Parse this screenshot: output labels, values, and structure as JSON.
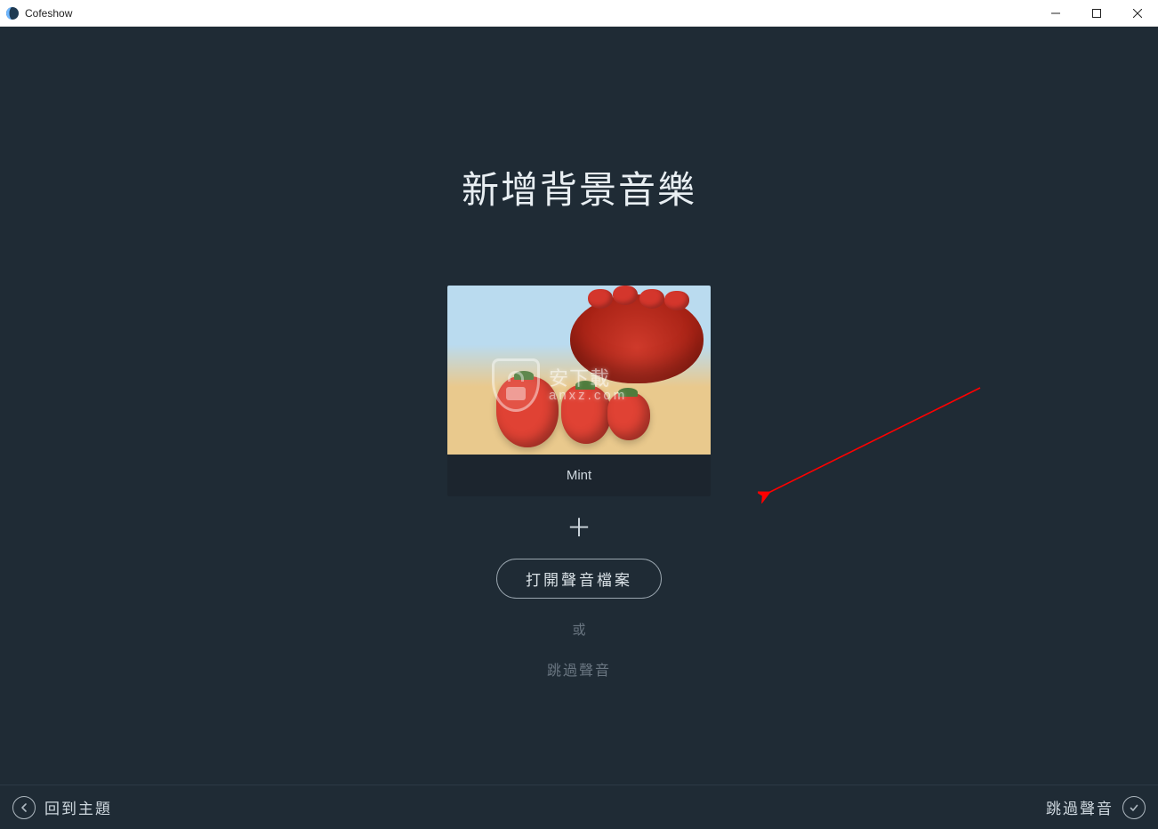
{
  "window": {
    "title": "Cofeshow"
  },
  "main": {
    "page_title": "新增背景音樂",
    "music_card": {
      "caption": "Mint"
    },
    "watermark": {
      "zh": "安下載",
      "en": "anxz.com"
    },
    "open_sound_label": "打開聲音檔案",
    "or_label": "或",
    "skip_sound_label": "跳過聲音"
  },
  "footer": {
    "back_label": "回到主題",
    "skip_label": "跳過聲音"
  }
}
